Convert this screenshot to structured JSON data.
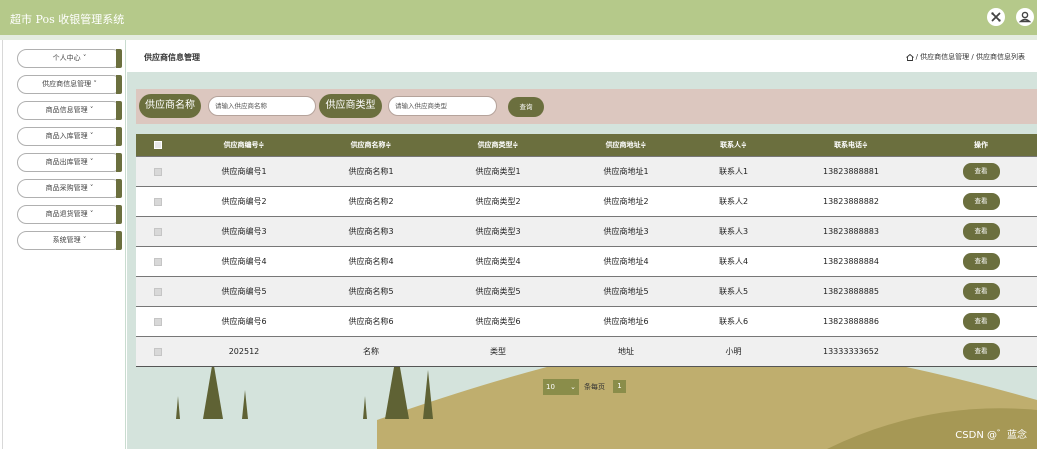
{
  "app": {
    "title": "超市 Pos 收银管理系统"
  },
  "header_icons": [
    "close-icon",
    "user-icon"
  ],
  "sidebar": {
    "items": [
      {
        "label": "个人中心 ˅"
      },
      {
        "label": "供应商信息管理 ˅"
      },
      {
        "label": "商品信息管理 ˅"
      },
      {
        "label": "商品入库管理 ˅"
      },
      {
        "label": "商品出库管理 ˅"
      },
      {
        "label": "商品采购管理 ˅"
      },
      {
        "label": "商品退货管理 ˅"
      },
      {
        "label": "系统管理 ˅"
      }
    ]
  },
  "page": {
    "title": "供应商信息管理",
    "breadcrumb": "/ 供应商信息管理 / 供应商信息列表"
  },
  "search": {
    "name_label": "供应商名称",
    "name_placeholder": "请输入供应商名称",
    "type_label": "供应商类型",
    "type_placeholder": "请输入供应商类型",
    "button": "查询"
  },
  "table": {
    "columns": [
      "供应商编号≑",
      "供应商名称≑",
      "供应商类型≑",
      "供应商地址≑",
      "联系人≑",
      "联系电话≑",
      "操作"
    ],
    "rows": [
      [
        "供应商编号1",
        "供应商名称1",
        "供应商类型1",
        "供应商地址1",
        "联系人1",
        "13823888881",
        "查看"
      ],
      [
        "供应商编号2",
        "供应商名称2",
        "供应商类型2",
        "供应商地址2",
        "联系人2",
        "13823888882",
        "查看"
      ],
      [
        "供应商编号3",
        "供应商名称3",
        "供应商类型3",
        "供应商地址3",
        "联系人3",
        "13823888883",
        "查看"
      ],
      [
        "供应商编号4",
        "供应商名称4",
        "供应商类型4",
        "供应商地址4",
        "联系人4",
        "13823888884",
        "查看"
      ],
      [
        "供应商编号5",
        "供应商名称5",
        "供应商类型5",
        "供应商地址5",
        "联系人5",
        "13823888885",
        "查看"
      ],
      [
        "供应商编号6",
        "供应商名称6",
        "供应商类型6",
        "供应商地址6",
        "联系人6",
        "13823888886",
        "查看"
      ],
      [
        "202512",
        "名称",
        "类型",
        "地址",
        "小明",
        "13333333652",
        "查看"
      ]
    ]
  },
  "pagination": {
    "page_size": "10",
    "per_page_label": "条每页",
    "current_page": "1"
  },
  "watermark": "CSDN @゛蓝念",
  "colors": {
    "topbar": "#b5c98a",
    "accent": "#6b6f3e",
    "search_bg": "#dcc7bf",
    "main_bg": "#d4e3dc"
  }
}
